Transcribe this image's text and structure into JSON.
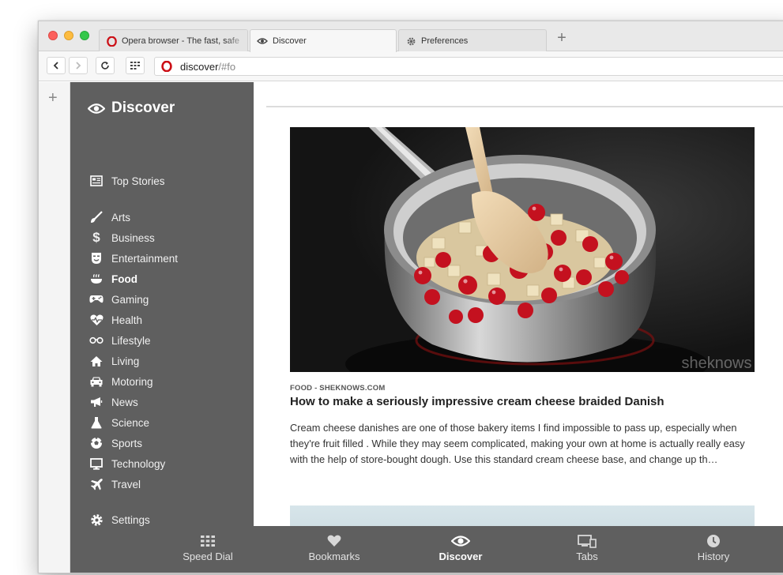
{
  "tabs": [
    {
      "label": "Opera browser - The fast, safe",
      "icon": "opera-logo-icon",
      "active": false
    },
    {
      "label": "Discover",
      "icon": "eye-icon",
      "active": true
    },
    {
      "label": "Preferences",
      "icon": "gear-icon",
      "active": false
    }
  ],
  "address": {
    "main": "discover",
    "suffix": "/#fo"
  },
  "sidebar": {
    "title": "Discover",
    "top_stories": "Top Stories",
    "categories": [
      "Arts",
      "Business",
      "Entertainment",
      "Food",
      "Gaming",
      "Health",
      "Lifestyle",
      "Living",
      "Motoring",
      "News",
      "Science",
      "Sports",
      "Technology",
      "Travel"
    ],
    "active_category": "Food",
    "settings": "Settings"
  },
  "article": {
    "source": "FOOD - SHEKNOWS.COM",
    "headline": "How to make a seriously impressive cream cheese braided Danish",
    "summary": "Cream cheese danishes are one of those bakery items I find impossible to pass up, especially when they're fruit filled . While they may seem complicated, making your own at home is actually really easy with the help of store-bought dough. Use this standard cream cheese base, and change up th…",
    "watermark": "sheknows"
  },
  "bottombar": {
    "items": [
      {
        "label": "Speed Dial",
        "icon": "grid-icon"
      },
      {
        "label": "Bookmarks",
        "icon": "heart-icon"
      },
      {
        "label": "Discover",
        "icon": "eye-icon"
      },
      {
        "label": "Tabs",
        "icon": "devices-icon"
      },
      {
        "label": "History",
        "icon": "clock-icon"
      }
    ],
    "active": "Discover"
  },
  "colors": {
    "sidebar_bg": "#5f5f5f",
    "opera_red": "#cc0f16",
    "cranberry": "#c4111f"
  }
}
